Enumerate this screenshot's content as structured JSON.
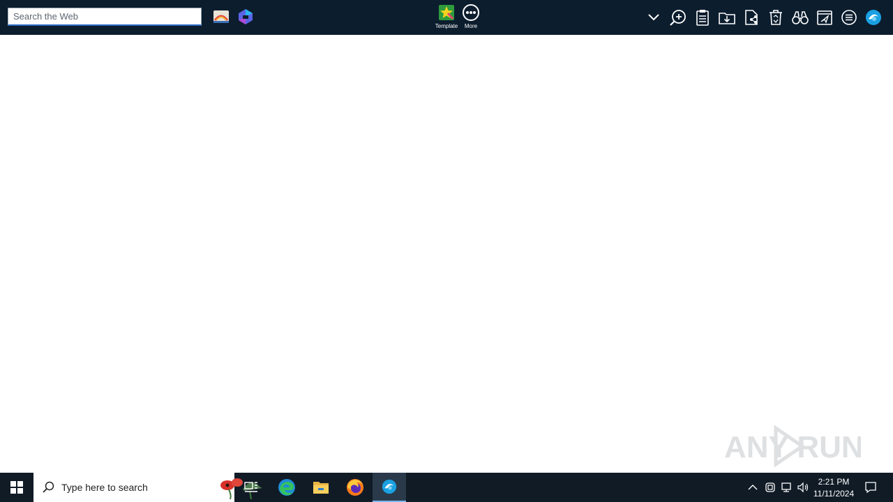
{
  "toolbar": {
    "search_placeholder": "Search the Web",
    "template_label": "Template",
    "more_label": "More",
    "icons": [
      "paint-icon",
      "copilot-icon",
      "template-icon",
      "more-icon",
      "chevron-down-icon",
      "zoom-icon",
      "clipboard-icon",
      "folder-download-icon",
      "file-share-icon",
      "recycle-bin-icon",
      "binoculars-icon",
      "send-icon",
      "menu-circle-icon",
      "app-logo-icon"
    ]
  },
  "taskbar": {
    "search_placeholder": "Type here to search",
    "time": "2:21 PM",
    "date": "11/11/2024",
    "apps": [
      "windows-start-icon",
      "task-view-icon",
      "edge-icon",
      "file-explorer-icon",
      "firefox-icon",
      "active-app-icon"
    ],
    "tray": [
      "chevron-up-icon",
      "meet-now-icon",
      "network-icon",
      "volume-icon",
      "notification-icon"
    ]
  },
  "watermark": {
    "text": "ANY RUN"
  },
  "colors": {
    "toolbar_bg": "#0c1d2e",
    "taskbar_bg": "#101b26",
    "accent": "#78b6f0"
  }
}
